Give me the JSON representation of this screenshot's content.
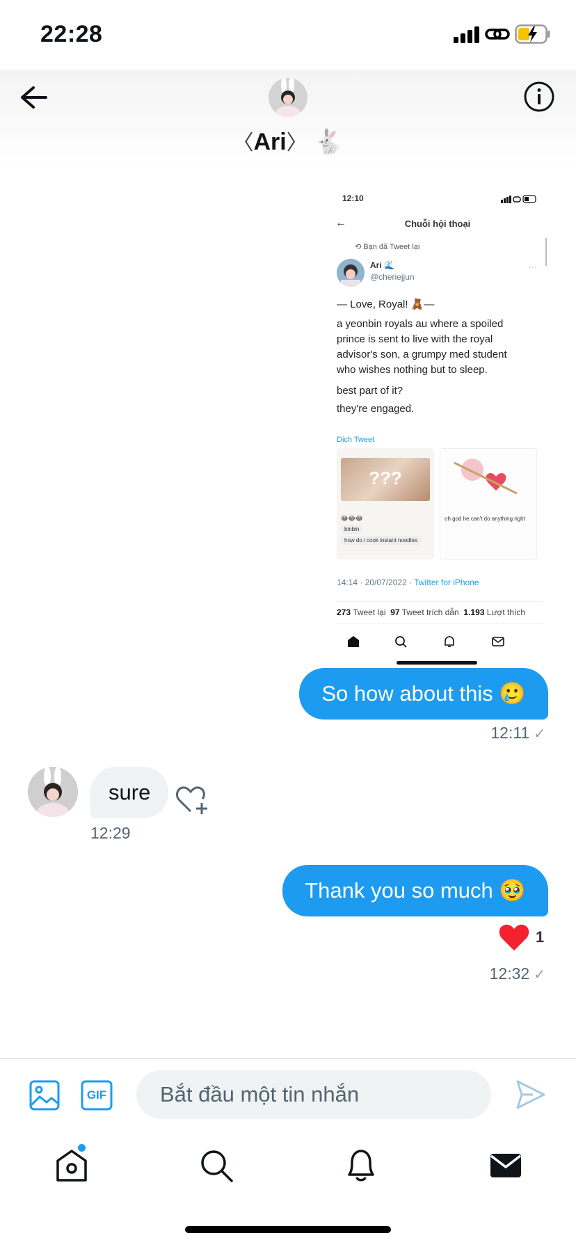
{
  "status_bar": {
    "time": "22:28"
  },
  "header": {
    "name": "Ari",
    "name_deco_left": "〈",
    "name_deco_right": "〉",
    "emoji": "🐇"
  },
  "shared_image": {
    "status_time": "12:10",
    "title": "Chuỗi hội thoại",
    "retweet_label": "Bạn đã Tweet lại",
    "author_name": "Ari 🌊",
    "author_handle": "@cheriejjun",
    "lines": [
      "— Love, Royal! 🧸—",
      "a yeonbin royals au where a spoiled",
      "prince is sent to live with the royal",
      "advisor's son, a grumpy med student",
      "who wishes nothing but to sleep.",
      "best part of it?",
      "they're engaged."
    ],
    "translate_link": "Dịch Tweet",
    "img1_text": "???",
    "img1_bubbles": [
      "binbin",
      "how do i cook instant noodles"
    ],
    "img2_text": "oh god he can't do anything right",
    "meta_time": "14:14 · 20/07/2022 · ",
    "meta_source": "Twitter for iPhone",
    "stats": {
      "retweets": "273",
      "retweets_label": "Tweet lại",
      "quotes": "97",
      "quotes_label": "Tweet trích dẫn",
      "likes": "1.193",
      "likes_label": "Lượt thích"
    }
  },
  "messages": [
    {
      "direction": "out",
      "text": "So how about this 🥲",
      "time": "12:11"
    },
    {
      "direction": "in",
      "text": "sure",
      "time": "12:29"
    },
    {
      "direction": "out",
      "text": "Thank you so much 🥹",
      "time": "12:32",
      "reaction": "❤",
      "reaction_count": "1"
    }
  ],
  "composer": {
    "placeholder": "Bắt đầu một tin nhắn",
    "gif_label": "GIF"
  },
  "colors": {
    "accent": "#1d9bf0",
    "bubble_in": "#eff3f4",
    "heart": "#f4212e"
  },
  "nav": {
    "items": [
      "home-icon",
      "search-icon",
      "notifications-icon",
      "messages-icon"
    ]
  }
}
